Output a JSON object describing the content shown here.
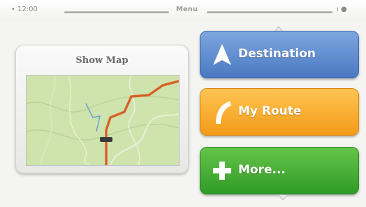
{
  "status_bar": {
    "left_text": "•  12:00",
    "title": "Menu",
    "right_text": "ı ●"
  },
  "show_map": {
    "title": "Show Map"
  },
  "menu": {
    "destination_label": "Destination",
    "my_route_label": "My Route",
    "more_label": "More..."
  },
  "icons": {
    "destination": "navigation-arrow-icon",
    "my_route": "route-curve-icon",
    "more": "plus-icon"
  },
  "colors": {
    "destination": "#4a78c2",
    "my_route": "#f39a18",
    "more": "#2f9b27",
    "route_line": "#e0652a"
  }
}
